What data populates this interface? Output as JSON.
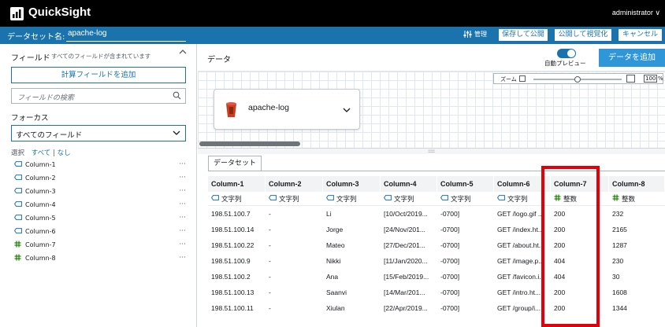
{
  "app": {
    "name": "QuickSight",
    "user": "administrator ∨"
  },
  "dataset_bar": {
    "label": "データセット名:",
    "name": "apache-log",
    "manage": "管理",
    "save_publish": "保存して公開",
    "publish_visualize": "公開して視覚化",
    "cancel": "キャンセル"
  },
  "fields_panel": {
    "title": "フィールド",
    "subtitle": "すべてのフィールドが含まれています",
    "add_calc": "計算フィールドを追加",
    "search_placeholder": "フィールドの検索",
    "focus_label": "フォーカス",
    "focus_value": "すべてのフィールド",
    "select_label": "選択",
    "select_all": "すべて",
    "select_sep": "|",
    "select_none": "なし",
    "items": [
      {
        "name": "Column-1",
        "type": "string"
      },
      {
        "name": "Column-2",
        "type": "string"
      },
      {
        "name": "Column-3",
        "type": "string"
      },
      {
        "name": "Column-4",
        "type": "string"
      },
      {
        "name": "Column-5",
        "type": "string"
      },
      {
        "name": "Column-6",
        "type": "string"
      },
      {
        "name": "Column-7",
        "type": "number"
      },
      {
        "name": "Column-8",
        "type": "number"
      }
    ],
    "more": "···"
  },
  "data_panel": {
    "title": "データ",
    "auto_preview": "自動プレビュー",
    "add_data": "データを追加",
    "zoom_label": "ズーム",
    "zoom_value": "100",
    "zoom_unit": "%",
    "card_name": "apache-log",
    "tab_label": "データセット"
  },
  "table": {
    "columns": [
      {
        "name": "Column-1",
        "type": "文字列",
        "kind": "string"
      },
      {
        "name": "Column-2",
        "type": "文字列",
        "kind": "string"
      },
      {
        "name": "Column-3",
        "type": "文字列",
        "kind": "string"
      },
      {
        "name": "Column-4",
        "type": "文字列",
        "kind": "string"
      },
      {
        "name": "Column-5",
        "type": "文字列",
        "kind": "string"
      },
      {
        "name": "Column-6",
        "type": "文字列",
        "kind": "string"
      },
      {
        "name": "Column-7",
        "type": "整数",
        "kind": "number"
      },
      {
        "name": "Column-8",
        "type": "整数",
        "kind": "number"
      }
    ],
    "rows": [
      [
        "198.51.100.7",
        "-",
        "Li",
        "[10/Oct/2019...",
        "-0700]",
        "GET /logo.gif ...",
        "200",
        "232"
      ],
      [
        "198.51.100.14",
        "-",
        "Jorge",
        "[24/Nov/201...",
        "-0700]",
        "GET /index.ht...",
        "200",
        "2165"
      ],
      [
        "198.51.100.22",
        "-",
        "Mateo",
        "[27/Dec/201...",
        "-0700]",
        "GET /about.ht...",
        "200",
        "1287"
      ],
      [
        "198.51.100.9",
        "-",
        "Nikki",
        "[11/Jan/2020...",
        "-0700]",
        "GET /image.p...",
        "404",
        "230"
      ],
      [
        "198.51.100.2",
        "-",
        "Ana",
        "[15/Feb/2019...",
        "-0700]",
        "GET /favicon.i...",
        "404",
        "30"
      ],
      [
        "198.51.100.13",
        "-",
        "Saanvi",
        "[14/Mar/201...",
        "-0700]",
        "GET /intro.ht...",
        "200",
        "1608"
      ],
      [
        "198.51.100.11",
        "-",
        "Xiulan",
        "[22/Apr/2019...",
        "-0700]",
        "GET /group/i...",
        "200",
        "1344"
      ]
    ]
  },
  "colors": {
    "brand_blue": "#1b73ad",
    "button_blue": "#2f96d8",
    "number_green": "#1d8102",
    "highlight_red": "#e3000b"
  }
}
